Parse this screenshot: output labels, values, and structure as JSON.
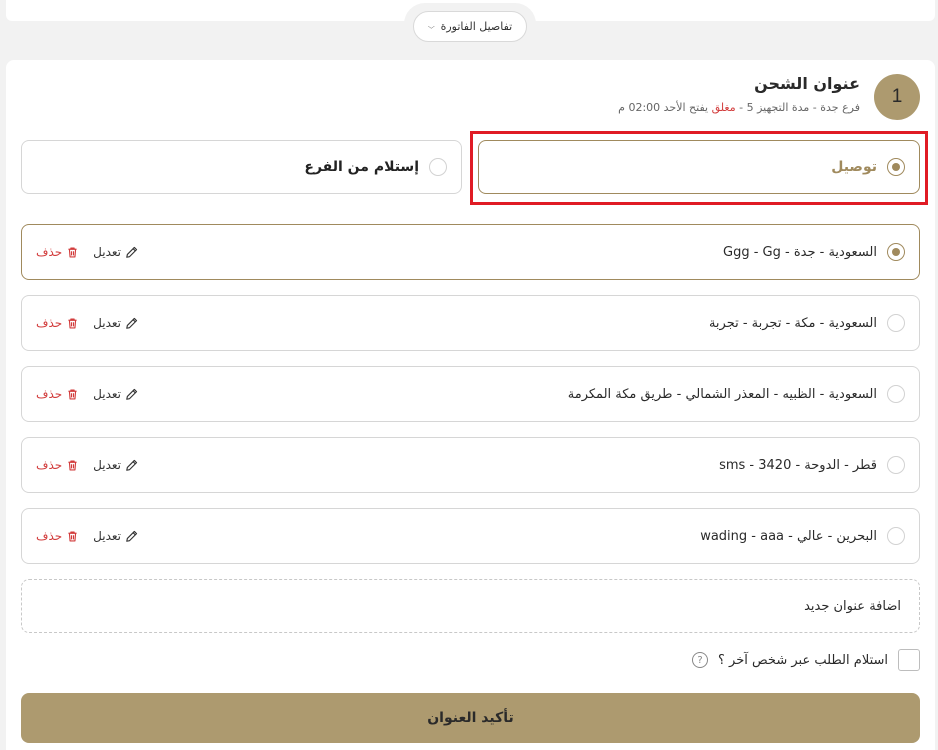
{
  "invoice_toggle": {
    "label": "تفاصيل الفاتورة",
    "icon": "chevron-down-icon"
  },
  "step": {
    "number": "1",
    "title": "عنوان الشحن",
    "subtitle_prefix": "فرع جدة - مدة التجهيز 5 -",
    "subtitle_status": "مغلق",
    "subtitle_suffix": "يفتح الأحد 02:00 م"
  },
  "methods": {
    "delivery_label": "توصيل",
    "pickup_label": "إستلام من الفرع"
  },
  "addresses": [
    {
      "text": "السعودية - جدة - Ggg - Gg",
      "selected": true
    },
    {
      "text": "السعودية - مكة - تجربة - تجربة",
      "selected": false
    },
    {
      "text": "السعودية - الظبيه - المعذر الشمالي - طريق مكة المكرمة",
      "selected": false
    },
    {
      "text": "قطر - الدوحة - 3420 - sms",
      "selected": false
    },
    {
      "text": "البحرين - عالي - wading - aaa",
      "selected": false
    }
  ],
  "actions": {
    "edit_label": "تعديل",
    "delete_label": "حذف"
  },
  "add_new_label": "اضافة عنوان جديد",
  "other_person_label": "استلام الطلب عبر شخص آخر ؟",
  "confirm_label": "تأكيد العنوان",
  "colors": {
    "accent": "#ad9a6f",
    "danger": "#d23b3b",
    "highlight": "#e01b24"
  }
}
